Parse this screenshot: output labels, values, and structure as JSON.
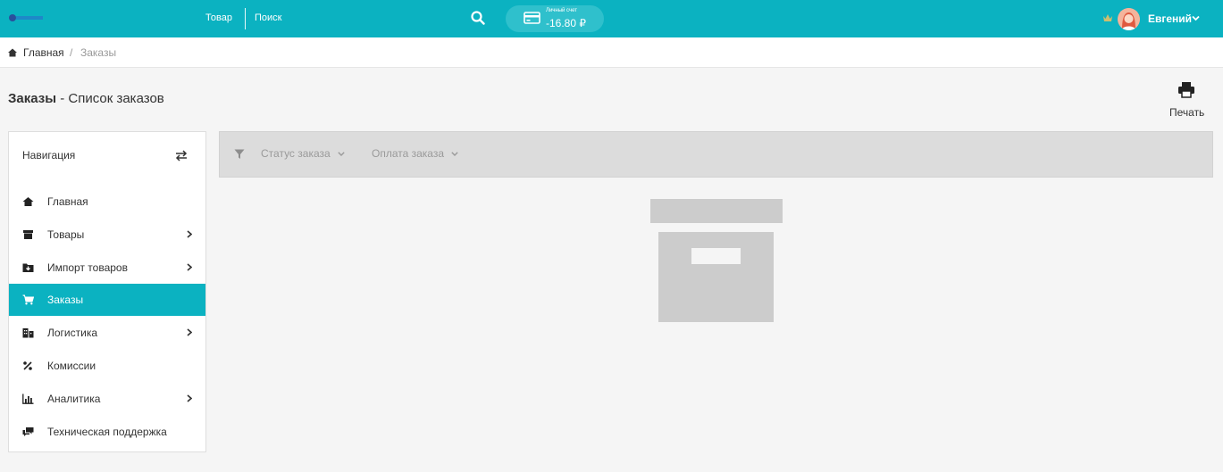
{
  "header": {
    "logo_icon": "logo",
    "links": {
      "product": "Товар",
      "search": "Поиск"
    },
    "search_icon": "search-icon",
    "account": {
      "label": "Личный счет",
      "balance": "-16.80 ₽",
      "icon": "card-icon"
    },
    "user": {
      "name": "Евгений",
      "crown_icon": "crown-icon",
      "chevron_icon": "chevron-down-icon"
    },
    "colors": {
      "bar": "#0bb2c1",
      "pill": "#2fc0cc"
    }
  },
  "breadcrumb": {
    "home": "Главная",
    "separator": "/",
    "current": "Заказы"
  },
  "page": {
    "title_bold": "Заказы",
    "title_rest": " - Список заказов",
    "print_label": "Печать"
  },
  "sidebar": {
    "title": "Навигация",
    "items": [
      {
        "label": "Главная",
        "icon": "home-icon",
        "has_submenu": false,
        "active": false
      },
      {
        "label": "Товары",
        "icon": "box-icon",
        "has_submenu": true,
        "active": false
      },
      {
        "label": "Импорт товаров",
        "icon": "folder-import-icon",
        "has_submenu": true,
        "active": false
      },
      {
        "label": "Заказы",
        "icon": "cart-icon",
        "has_submenu": false,
        "active": true
      },
      {
        "label": "Логистика",
        "icon": "buildings-icon",
        "has_submenu": true,
        "active": false
      },
      {
        "label": "Комиссии",
        "icon": "percent-icon",
        "has_submenu": false,
        "active": false
      },
      {
        "label": "Аналитика",
        "icon": "bar-chart-icon",
        "has_submenu": true,
        "active": false
      },
      {
        "label": "Техническая поддержка",
        "icon": "chat-icon",
        "has_submenu": false,
        "active": false
      }
    ],
    "active_color": "#0bb2c1"
  },
  "filters": {
    "status": "Статус заказа",
    "payment": "Оплата заказа"
  },
  "empty_state": {
    "icon": "archive-box-icon"
  }
}
